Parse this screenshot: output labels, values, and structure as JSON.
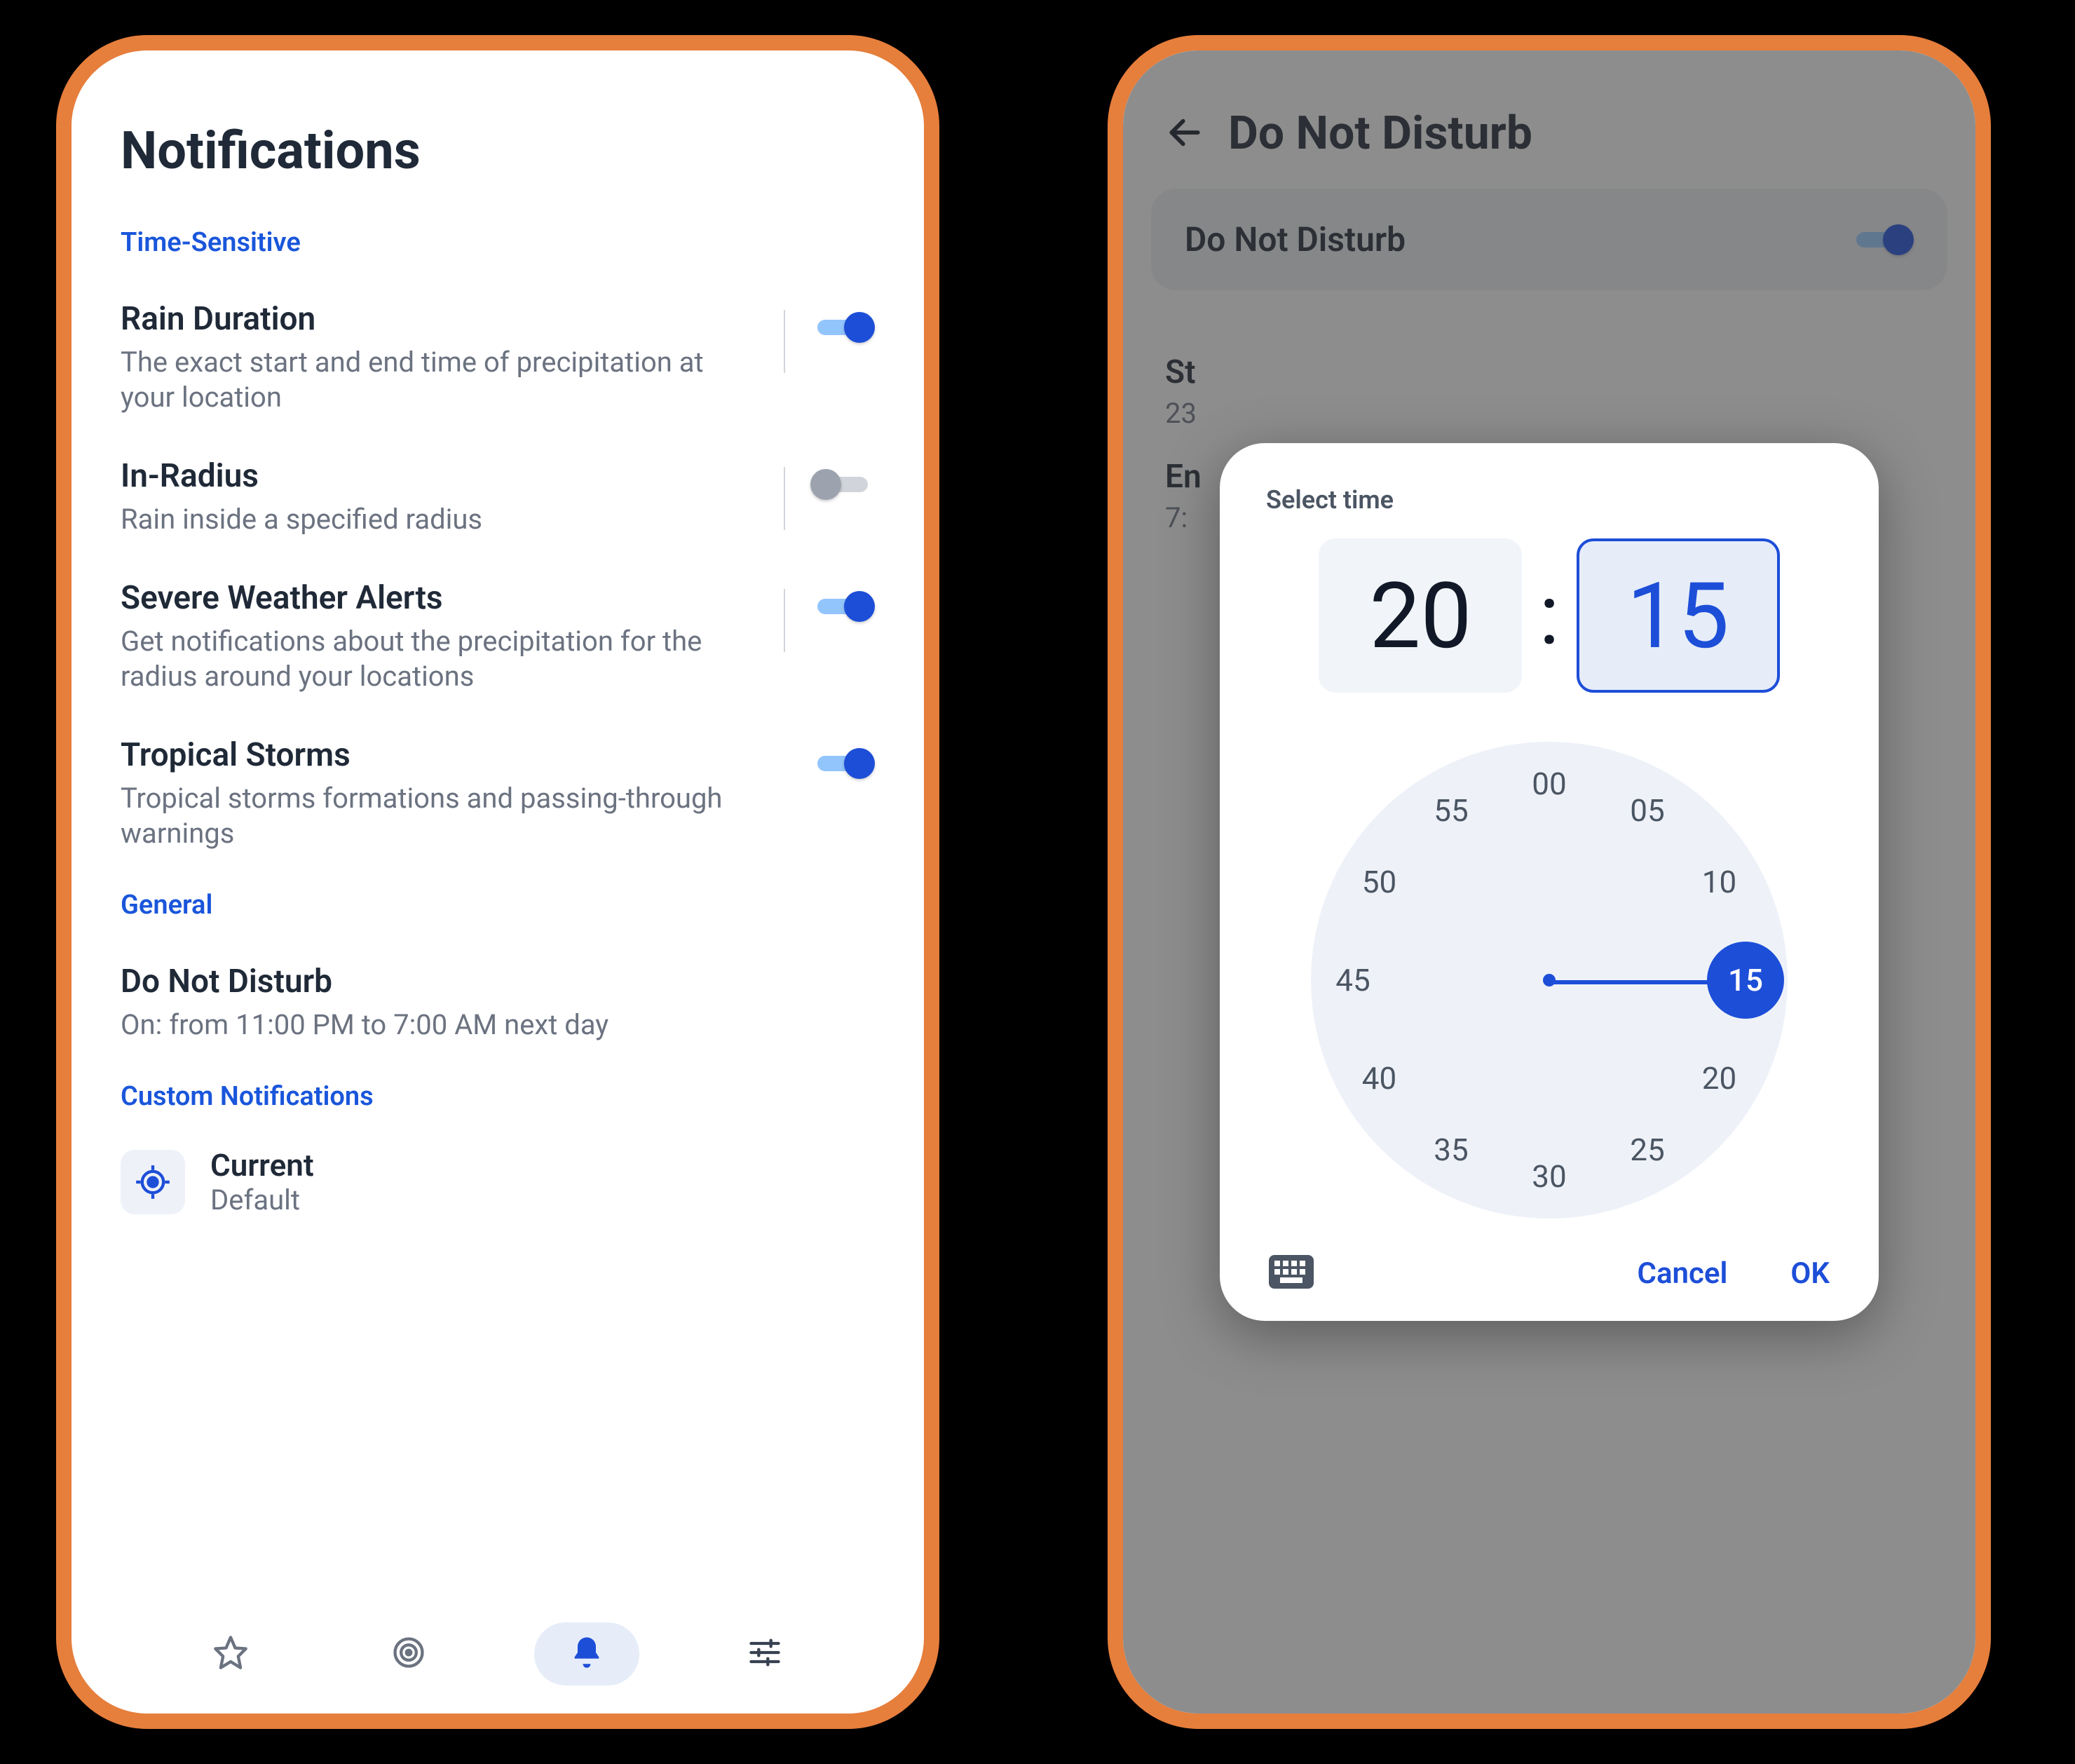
{
  "left": {
    "title": "Notifications",
    "sections": {
      "time_sensitive_label": "Time-Sensitive",
      "general_label": "General",
      "custom_label": "Custom Notifications"
    },
    "rain_duration": {
      "title": "Rain Duration",
      "desc": "The exact start and end time of precipitation at your location",
      "on": true
    },
    "in_radius": {
      "title": "In-Radius",
      "desc": "Rain inside a specified radius",
      "on": false
    },
    "severe": {
      "title": "Severe Weather Alerts",
      "desc": "Get notifications about the precipitation for the radius around your locations",
      "on": true
    },
    "tropical": {
      "title": "Tropical Storms",
      "desc": "Tropical storms formations and passing-through warnings",
      "on": true
    },
    "dnd": {
      "title": "Do Not Disturb",
      "desc": "On: from 11:00 PM to 7:00 AM next day"
    },
    "custom_item": {
      "title": "Current",
      "desc": "Default"
    }
  },
  "right": {
    "header": "Do Not Disturb",
    "card_label": "Do Not Disturb",
    "card_on": true,
    "start_label": "St",
    "start_value": "23",
    "end_label": "En",
    "end_value": "7:"
  },
  "dialog": {
    "title": "Select time",
    "hour": "20",
    "minute": "15",
    "clock_numbers": [
      "00",
      "05",
      "10",
      "15",
      "20",
      "25",
      "30",
      "35",
      "40",
      "45",
      "50",
      "55"
    ],
    "selected_index": 3,
    "cancel": "Cancel",
    "ok": "OK"
  }
}
